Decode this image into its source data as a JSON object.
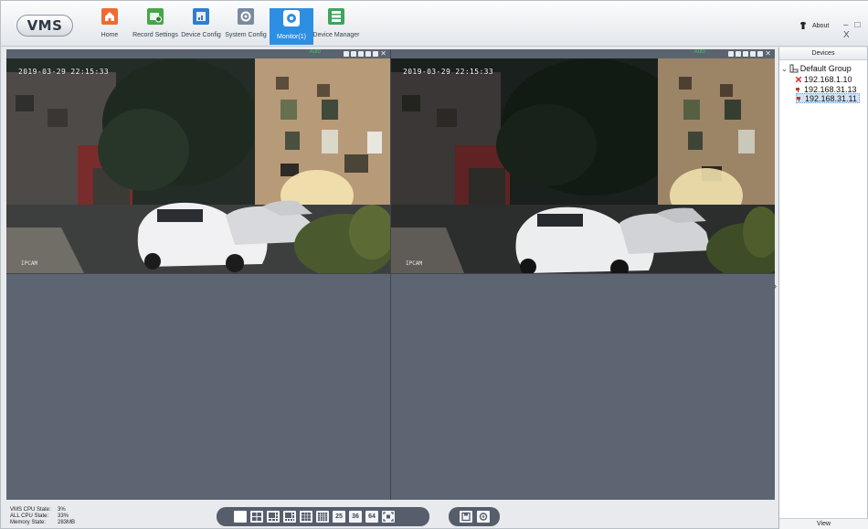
{
  "app": {
    "logo": "VMS"
  },
  "nav": [
    {
      "id": "home",
      "label": "Home",
      "icon": "home-icon",
      "color": "#f06a33"
    },
    {
      "id": "record",
      "label": "Record Settings",
      "icon": "record-settings-icon",
      "color": "#47a64a"
    },
    {
      "id": "device-config",
      "label": "Device Config",
      "icon": "device-config-icon",
      "color": "#2c7fd3"
    },
    {
      "id": "system-config",
      "label": "System Config",
      "icon": "system-config-icon",
      "color": "#7a8aa0"
    },
    {
      "id": "monitor",
      "label": "Monitor(1)",
      "icon": "monitor-icon",
      "color": "#ffffff",
      "active": true
    },
    {
      "id": "device-manager",
      "label": "Device Manager",
      "icon": "device-manager-icon",
      "color": "#3ea55b"
    }
  ],
  "header": {
    "about_label": "About",
    "window_controls": "– □ X"
  },
  "panes": {
    "top_left": {
      "auto_label": "Auto",
      "timestamp": "2019-03-29 22:15:33",
      "camera_name": "IPCAM"
    },
    "top_right": {
      "auto_label": "Auto",
      "timestamp": "2019-03-29 22:15:33",
      "camera_name": "IPCAM"
    }
  },
  "devices": {
    "title": "Devices",
    "group": "Default Group",
    "items": [
      {
        "ip": "192.168.1.10",
        "status": "offline"
      },
      {
        "ip": "192.168.31.13",
        "status": "online"
      },
      {
        "ip": "192.168.31.11",
        "status": "online",
        "selected": true
      }
    ],
    "view_tab": "View"
  },
  "status": {
    "vms_cpu_label": "VMS CPU State:",
    "vms_cpu_value": "3%",
    "all_cpu_label": "ALL CPU State:",
    "all_cpu_value": "33%",
    "memory_label": "Memory State:",
    "memory_value": "283MB"
  },
  "layout_bar": {
    "buttons": [
      "1",
      "4",
      "6",
      "8",
      "9",
      "16"
    ],
    "labels": {
      "b25": "25",
      "b36": "36",
      "b64": "64"
    }
  },
  "colors": {
    "accent": "#2d8fe2",
    "video_bg": "#5d6573",
    "bar_bg": "#565e6b",
    "auto_green": "#3bd04c"
  }
}
